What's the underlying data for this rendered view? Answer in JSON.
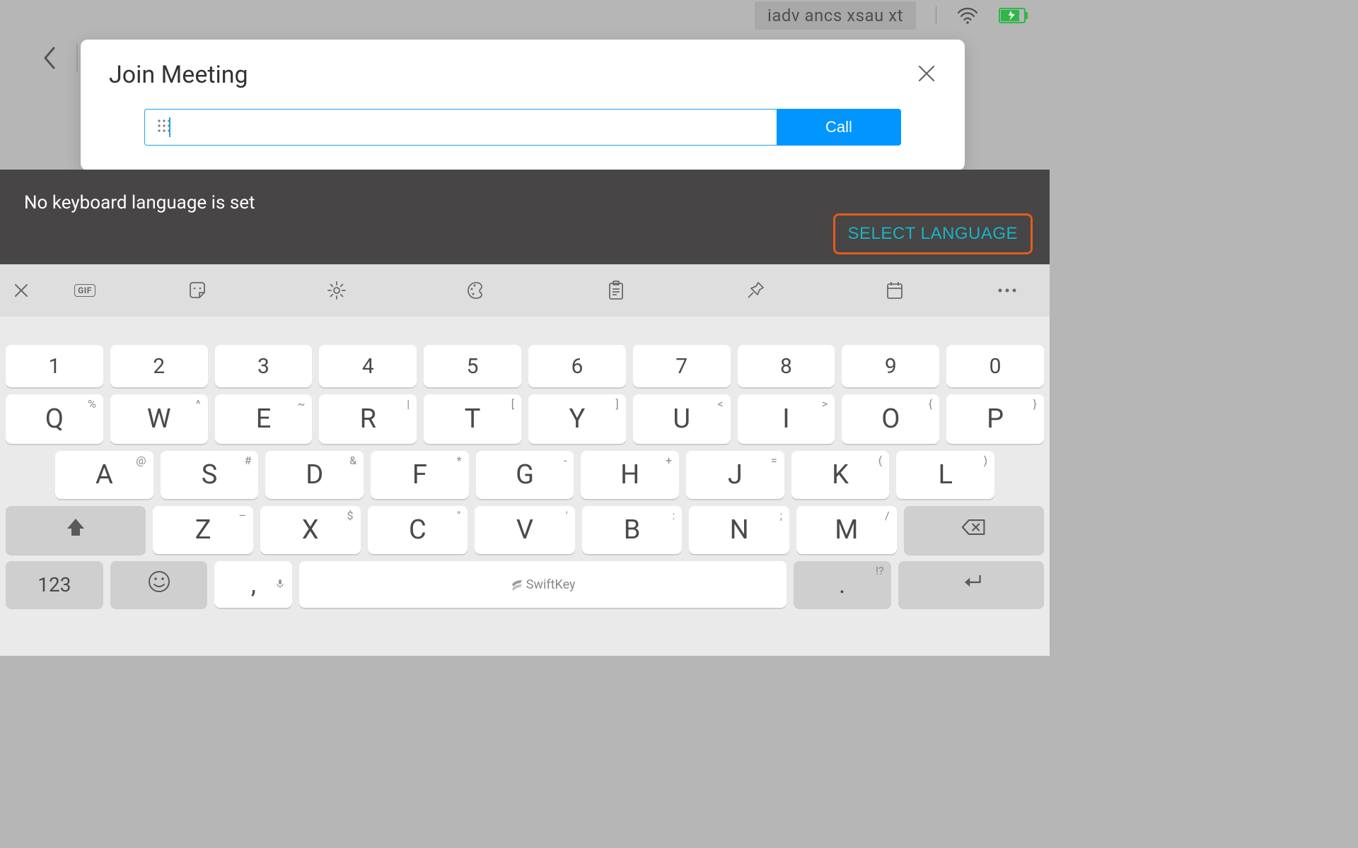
{
  "statusbar": {
    "label": "iadv ancs xsau xt"
  },
  "card": {
    "title": "Join Meeting",
    "call_label": "Call",
    "input_value": ""
  },
  "banner": {
    "message": "No keyboard language is set",
    "select_label": "SELECT LANGUAGE"
  },
  "keyboard": {
    "gif_label": "GIF",
    "rows": {
      "numbers": [
        "1",
        "2",
        "3",
        "4",
        "5",
        "6",
        "7",
        "8",
        "9",
        "0"
      ],
      "qwerty": [
        {
          "k": "Q",
          "s": "%"
        },
        {
          "k": "W",
          "s": "^"
        },
        {
          "k": "E",
          "s": "~"
        },
        {
          "k": "R",
          "s": "|"
        },
        {
          "k": "T",
          "s": "["
        },
        {
          "k": "Y",
          "s": "]"
        },
        {
          "k": "U",
          "s": "<"
        },
        {
          "k": "I",
          "s": ">"
        },
        {
          "k": "O",
          "s": "{"
        },
        {
          "k": "P",
          "s": "}"
        }
      ],
      "asdf": [
        {
          "k": "A",
          "s": "@"
        },
        {
          "k": "S",
          "s": "#"
        },
        {
          "k": "D",
          "s": "&"
        },
        {
          "k": "F",
          "s": "*"
        },
        {
          "k": "G",
          "s": "-"
        },
        {
          "k": "H",
          "s": "+"
        },
        {
          "k": "J",
          "s": "="
        },
        {
          "k": "K",
          "s": "("
        },
        {
          "k": "L",
          "s": ")"
        }
      ],
      "zxcv": [
        {
          "k": "Z",
          "s": "–"
        },
        {
          "k": "X",
          "s": "$"
        },
        {
          "k": "C",
          "s": "\""
        },
        {
          "k": "V",
          "s": "'"
        },
        {
          "k": "B",
          "s": ":"
        },
        {
          "k": "N",
          "s": ";"
        },
        {
          "k": "M",
          "s": "/"
        }
      ]
    },
    "bottom": {
      "numbers_label": "123",
      "comma": ",",
      "space_label": "SwiftKey",
      "period": ".",
      "period_sup": "!?"
    }
  }
}
